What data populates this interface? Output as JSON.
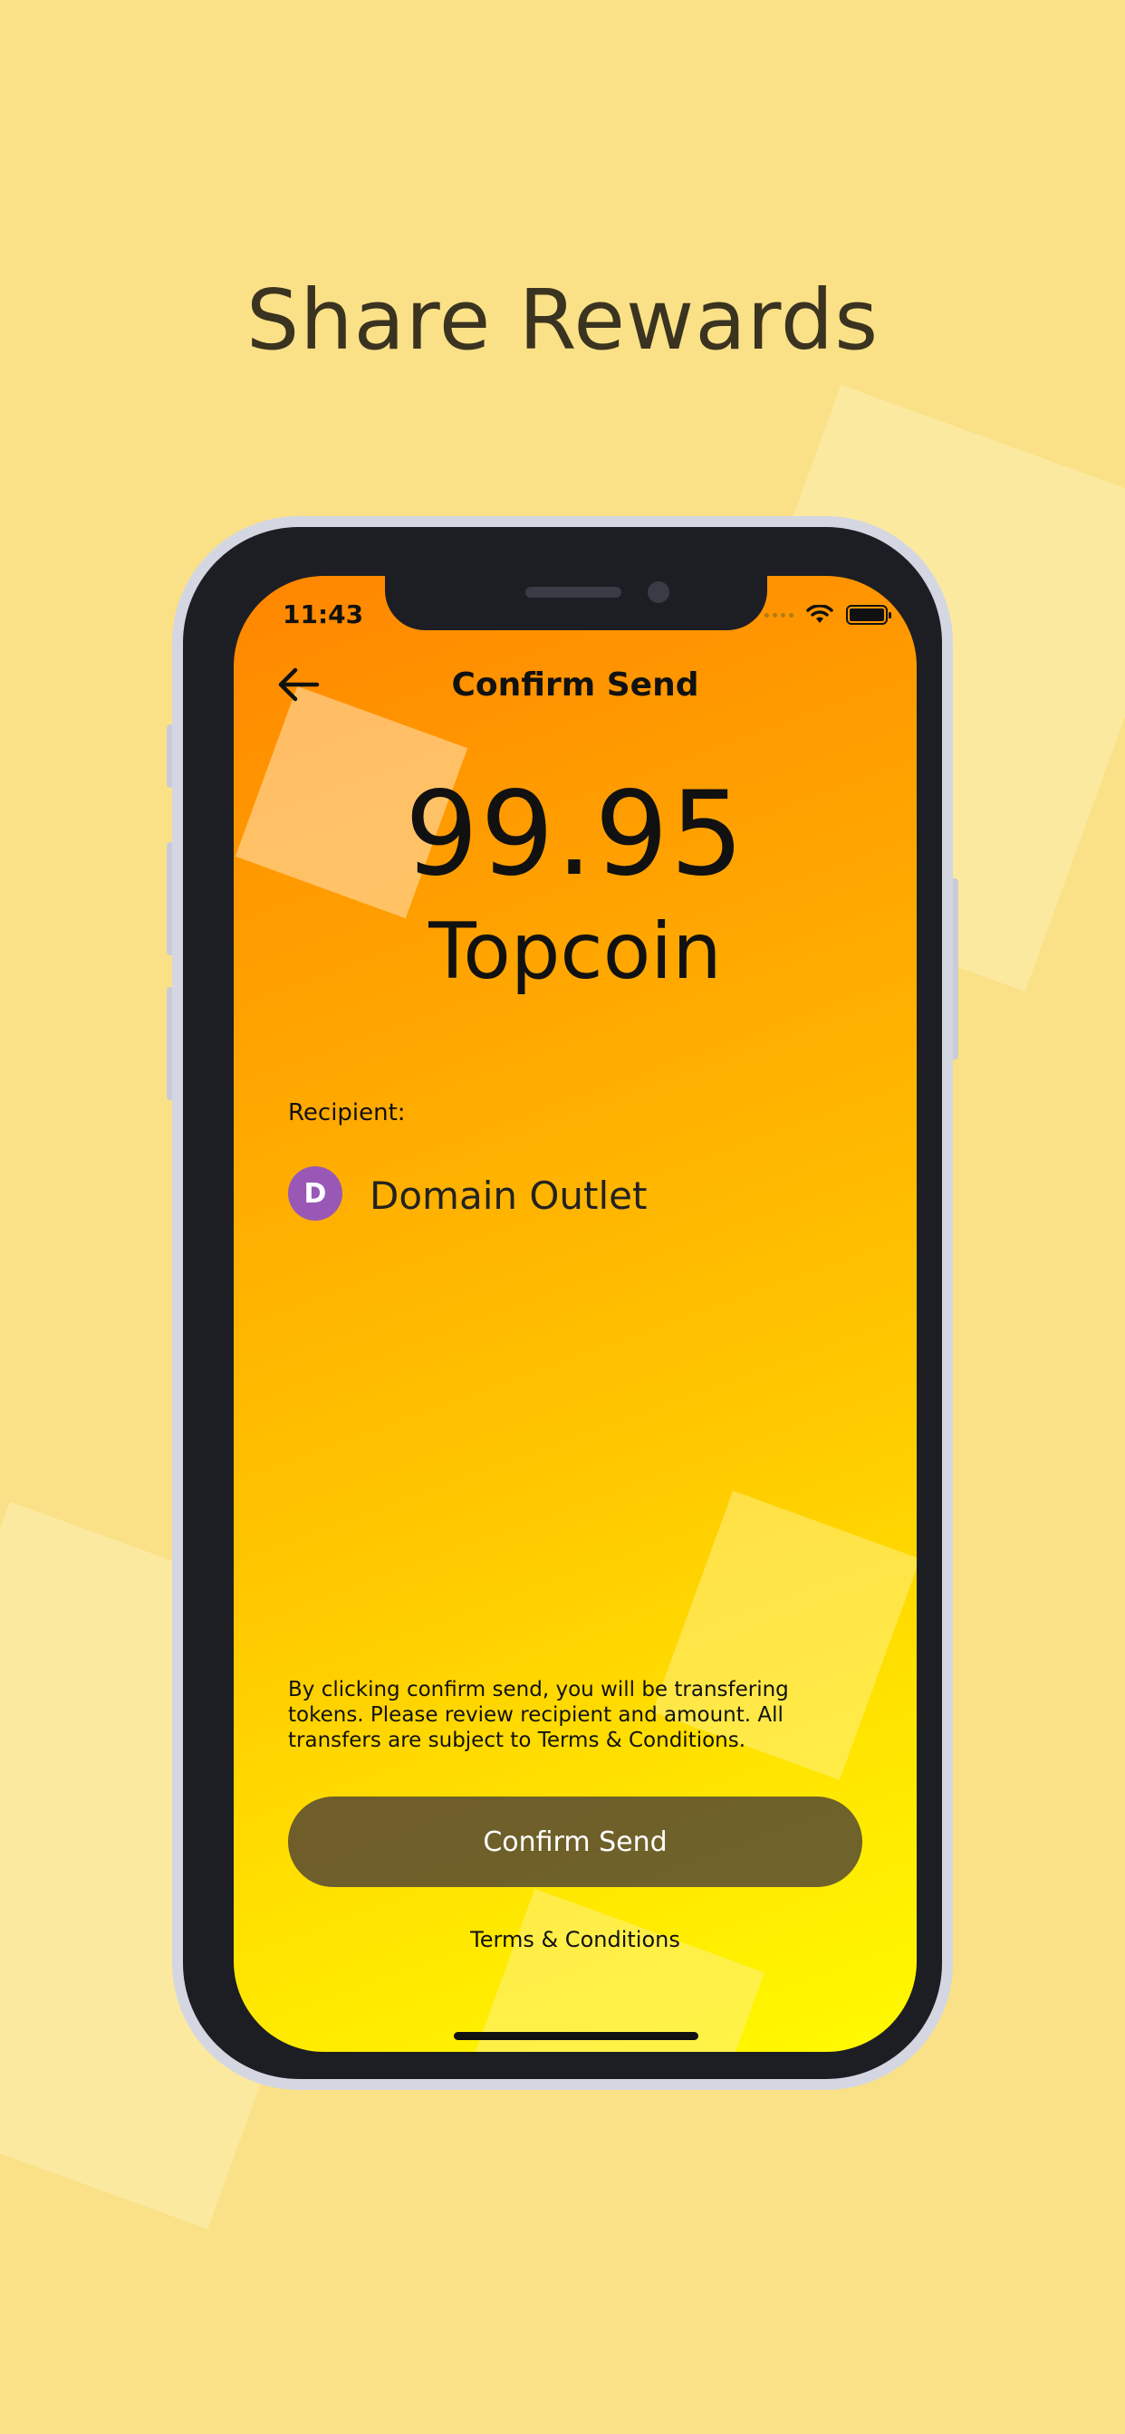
{
  "promo": {
    "headline": "Share Rewards"
  },
  "status_bar": {
    "time": "11:43"
  },
  "nav": {
    "title": "Confirm Send",
    "back_icon": "arrow-left-icon"
  },
  "amount": {
    "value": "99.95",
    "currency": "Topcoin"
  },
  "recipient": {
    "label": "Recipient:",
    "avatar_initial": "D",
    "name": "Domain Outlet",
    "avatar_color": "#9a58b6"
  },
  "footer": {
    "disclaimer": "By clicking confirm send, you will be transfering tokens. Please review recipient and amount.  All transfers are subject to Terms & Conditions.",
    "confirm_label": "Confirm Send",
    "terms_label": "Terms & Conditions"
  },
  "colors": {
    "background": "#fae187",
    "gradient_start": "#ff8600",
    "gradient_end": "#fffa00",
    "button": "#5a4a3a"
  }
}
